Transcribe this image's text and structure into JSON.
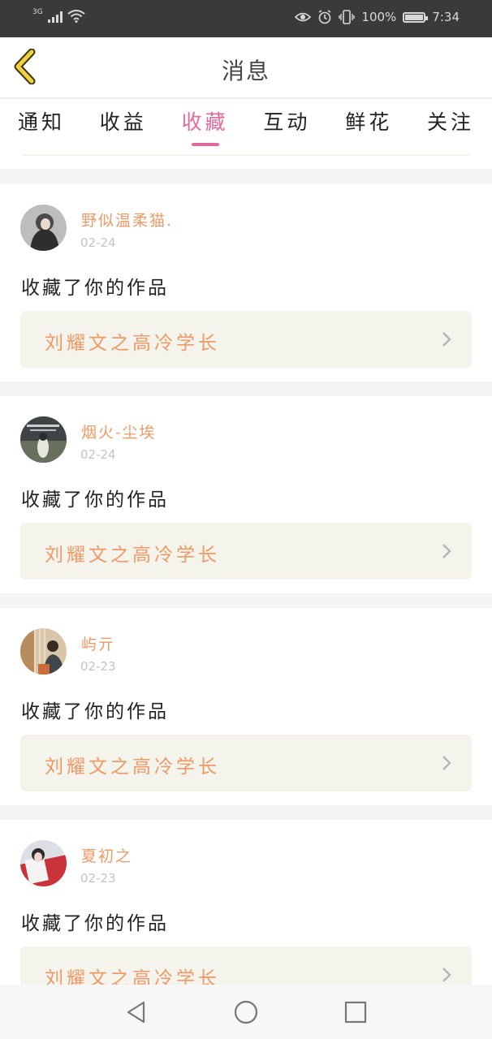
{
  "status_bar": {
    "network": "3G",
    "battery_percent": "100%",
    "time": "7:34"
  },
  "header": {
    "title": "消息"
  },
  "tabs": [
    {
      "label": "通知",
      "active": false
    },
    {
      "label": "收益",
      "active": false
    },
    {
      "label": "收藏",
      "active": true
    },
    {
      "label": "互动",
      "active": false
    },
    {
      "label": "鲜花",
      "active": false
    },
    {
      "label": "关注",
      "active": false
    }
  ],
  "messages": [
    {
      "user": "野似温柔猫.",
      "date": "02-24",
      "text": "收藏了你的作品",
      "work_title": "刘耀文之高冷学长"
    },
    {
      "user": "烟火-尘埃",
      "date": "02-24",
      "text": "收藏了你的作品",
      "work_title": "刘耀文之高冷学长"
    },
    {
      "user": "屿亓",
      "date": "02-23",
      "text": "收藏了你的作品",
      "work_title": "刘耀文之高冷学长"
    },
    {
      "user": "夏初之",
      "date": "02-23",
      "text": "收藏了你的作品",
      "work_title": "刘耀文之高冷学长"
    }
  ],
  "colors": {
    "accent_pink": "#e26a98",
    "name_orange": "#ee9a66",
    "back_yellow": "#f2d23c",
    "card_bg": "#f4f3ec"
  },
  "icons": {
    "back": "chevron-left-icon",
    "card_arrow": "chevron-right-icon",
    "nav_back": "triangle-back-icon",
    "nav_home": "circle-home-icon",
    "nav_recent": "square-recent-icon"
  }
}
